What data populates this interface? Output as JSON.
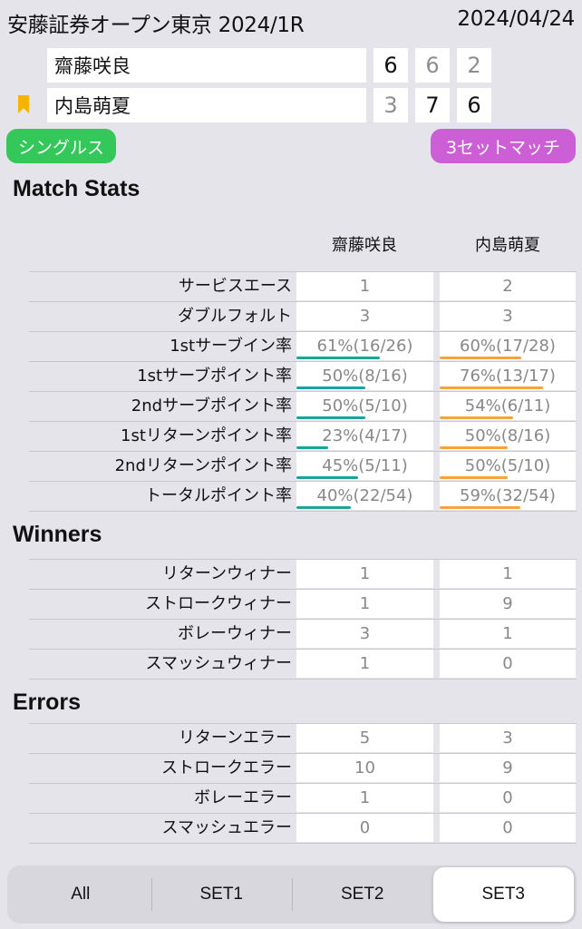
{
  "header": {
    "title": "安藤証券オープン東京 2024/1R",
    "date": "2024/04/24"
  },
  "players": [
    {
      "name": "齋藤咲良",
      "sets": [
        "6",
        "6",
        "2"
      ],
      "set_won": [
        true,
        false,
        false
      ]
    },
    {
      "name": "内島萌夏",
      "sets": [
        "3",
        "7",
        "6"
      ],
      "set_won": [
        false,
        true,
        true
      ]
    }
  ],
  "badges": {
    "match_type": "シングルス",
    "format": "3セットマッチ"
  },
  "colors": {
    "p1_bar": "#1aa59a",
    "p2_bar": "#f6a33a",
    "singles_pill": "#34c759",
    "format_pill": "#cc5fd6",
    "bookmark": "#f4b400"
  },
  "match_stats": {
    "title": "Match Stats",
    "col1": "齋藤咲良",
    "col2": "内島萌夏",
    "rows": [
      {
        "label": "サービスエース",
        "p1": "1",
        "p2": "2"
      },
      {
        "label": "ダブルフォルト",
        "p1": "3",
        "p2": "3"
      },
      {
        "label": "1stサーブイン率",
        "p1": "61%(16/26)",
        "p2": "60%(17/28)",
        "p1_pct": 61,
        "p2_pct": 60
      },
      {
        "label": "1stサーブポイント率",
        "p1": "50%(8/16)",
        "p2": "76%(13/17)",
        "p1_pct": 50,
        "p2_pct": 76
      },
      {
        "label": "2ndサーブポイント率",
        "p1": "50%(5/10)",
        "p2": "54%(6/11)",
        "p1_pct": 50,
        "p2_pct": 54
      },
      {
        "label": "1stリターンポイント率",
        "p1": "23%(4/17)",
        "p2": "50%(8/16)",
        "p1_pct": 23,
        "p2_pct": 50
      },
      {
        "label": "2ndリターンポイント率",
        "p1": "45%(5/11)",
        "p2": "50%(5/10)",
        "p1_pct": 45,
        "p2_pct": 50
      },
      {
        "label": "トータルポイント率",
        "p1": "40%(22/54)",
        "p2": "59%(32/54)",
        "p1_pct": 40,
        "p2_pct": 59
      }
    ]
  },
  "winners": {
    "title": "Winners",
    "rows": [
      {
        "label": "リターンウィナー",
        "p1": "1",
        "p2": "1"
      },
      {
        "label": "ストロークウィナー",
        "p1": "1",
        "p2": "9"
      },
      {
        "label": "ボレーウィナー",
        "p1": "3",
        "p2": "1"
      },
      {
        "label": "スマッシュウィナー",
        "p1": "1",
        "p2": "0"
      }
    ]
  },
  "errors": {
    "title": "Errors",
    "rows": [
      {
        "label": "リターンエラー",
        "p1": "5",
        "p2": "3"
      },
      {
        "label": "ストロークエラー",
        "p1": "10",
        "p2": "9"
      },
      {
        "label": "ボレーエラー",
        "p1": "1",
        "p2": "0"
      },
      {
        "label": "スマッシュエラー",
        "p1": "0",
        "p2": "0"
      }
    ]
  },
  "segments": {
    "items": [
      "All",
      "SET1",
      "SET2",
      "SET3"
    ],
    "selected": "SET3"
  }
}
